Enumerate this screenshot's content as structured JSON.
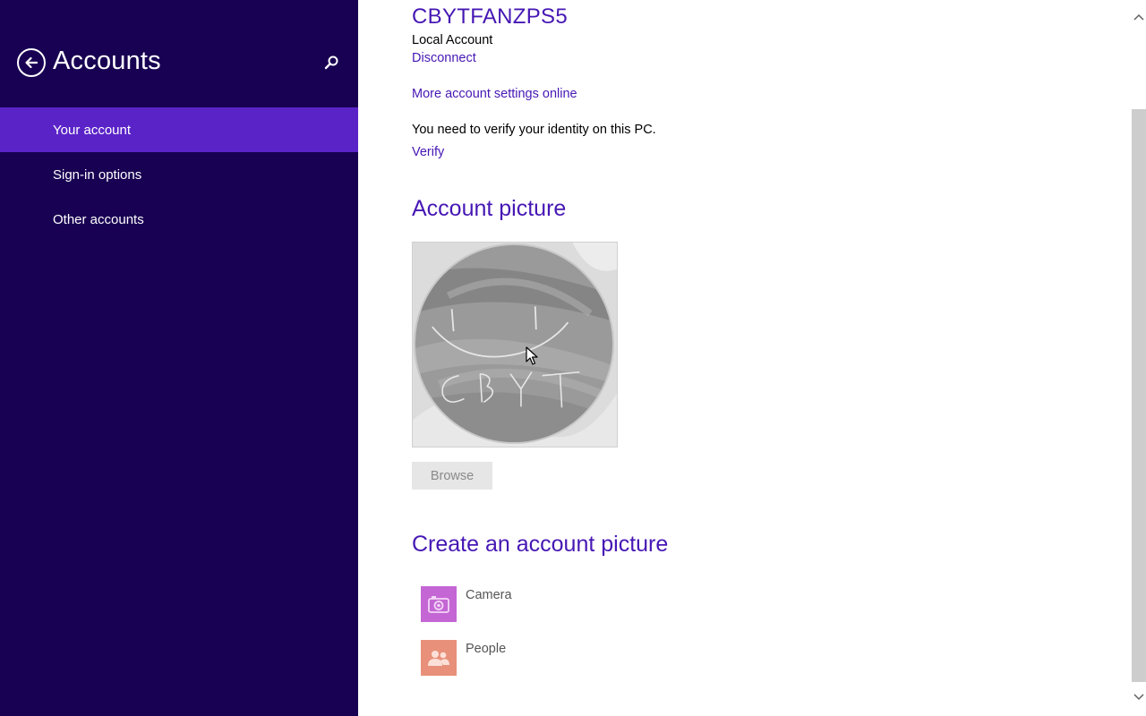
{
  "sidebar": {
    "title": "Accounts",
    "icons": {
      "back": "back-arrow-icon",
      "search": "search-icon"
    },
    "items": [
      {
        "label": "Your account",
        "active": true
      },
      {
        "label": "Sign-in options",
        "active": false
      },
      {
        "label": "Other accounts",
        "active": false
      }
    ]
  },
  "account": {
    "name": "CBYTFANZPS5",
    "type": "Local Account",
    "disconnect_label": "Disconnect",
    "more_settings_label": "More account settings online",
    "verify_message": "You need to verify your identity on this PC.",
    "verify_label": "Verify"
  },
  "account_picture": {
    "title": "Account picture",
    "browse_label": "Browse"
  },
  "create_picture": {
    "title": "Create an account picture",
    "apps": [
      {
        "label": "Camera",
        "icon": "camera-icon",
        "color": "#c466d4"
      },
      {
        "label": "People",
        "icon": "people-icon",
        "color": "#e8907a"
      }
    ]
  },
  "colors": {
    "sidebar_bg": "#180052",
    "active_item": "#5a23c8",
    "accent_text": "#4617b4"
  }
}
